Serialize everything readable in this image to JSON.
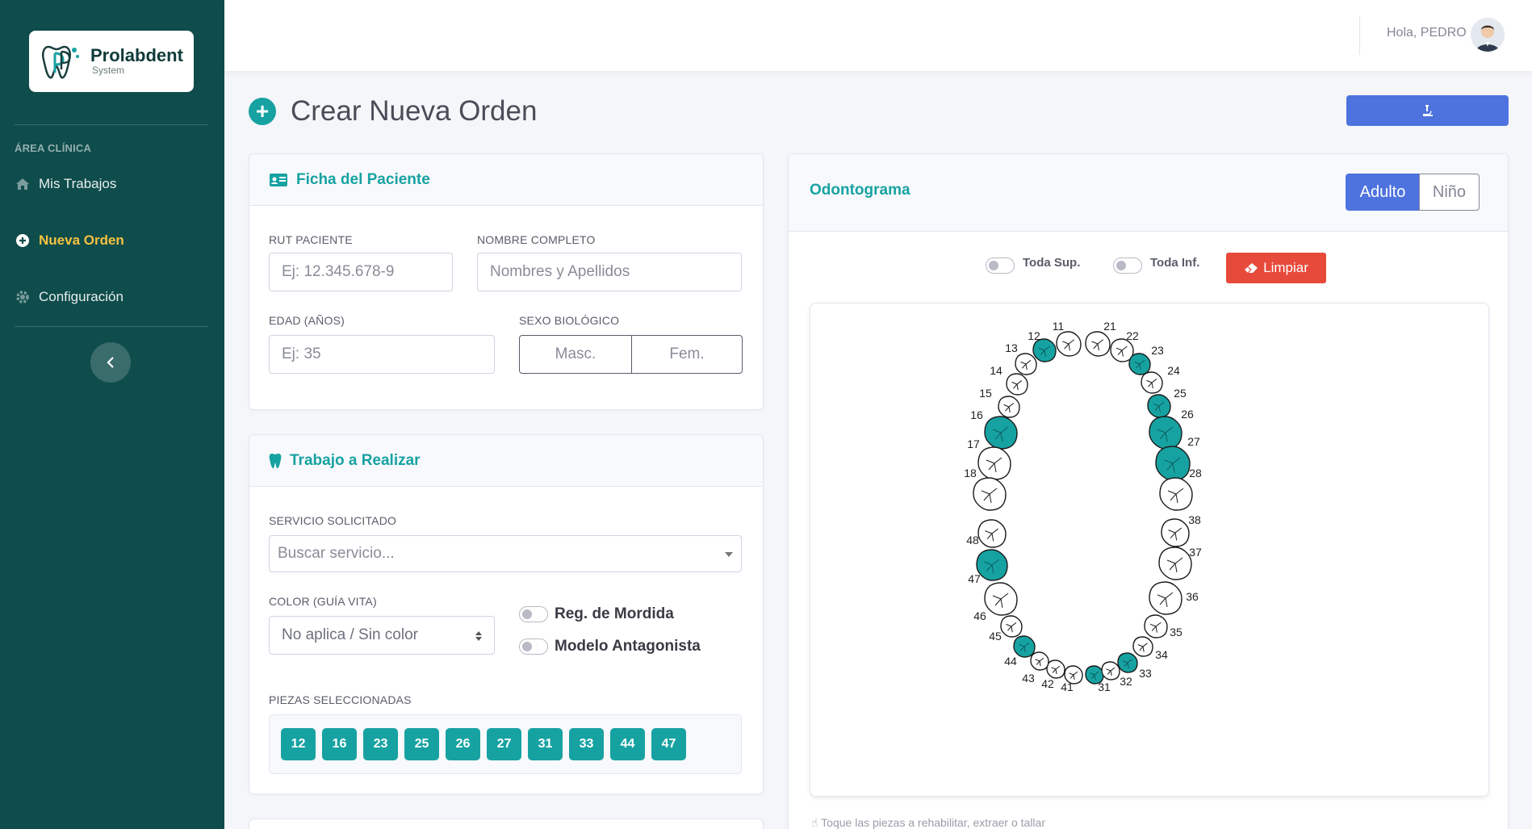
{
  "brand": {
    "name": "Prolabdent",
    "sub": "System"
  },
  "sidebar": {
    "heading": "ÁREA CLÍNICA",
    "items": [
      {
        "label": "Mis Trabajos",
        "icon": "home-icon"
      },
      {
        "label": "Nueva Orden",
        "icon": "plus-circle-icon",
        "active": true
      },
      {
        "label": "Configuración",
        "icon": "gear-icon"
      }
    ]
  },
  "topbar": {
    "greeting": "Hola, PEDRO"
  },
  "page": {
    "title": "Crear Nueva Orden"
  },
  "patient": {
    "title": "Ficha del Paciente",
    "rut_label": "RUT PACIENTE",
    "rut_placeholder": "Ej: 12.345.678-9",
    "name_label": "NOMBRE COMPLETO",
    "name_placeholder": "Nombres y Apellidos",
    "age_label": "EDAD (AÑOS)",
    "age_placeholder": "Ej: 35",
    "sex_label": "SEXO BIOLÓGICO",
    "sex_options": [
      "Masc.",
      "Fem."
    ]
  },
  "work": {
    "title": "Trabajo a Realizar",
    "service_label": "SERVICIO SOLICITADO",
    "service_placeholder": "Buscar servicio...",
    "color_label": "COLOR (GUÍA VITA)",
    "color_value": "No aplica / Sin color",
    "toggle_bite": "Reg. de Mordida",
    "toggle_antagonist": "Modelo Antagonista",
    "pieces_label": "PIEZAS SELECCIONADAS",
    "pieces": [
      "12",
      "16",
      "23",
      "25",
      "26",
      "27",
      "31",
      "33",
      "44",
      "47"
    ]
  },
  "odontogram": {
    "title": "Odontograma",
    "mode_adult": "Adulto",
    "mode_child": "Niño",
    "toggle_upper": "Toda Sup.",
    "toggle_lower": "Toda Inf.",
    "clear_label": "Limpiar",
    "hint": "Toque las piezas a rehabilitar, extraer o tallar",
    "selected_color": "#17a2a2",
    "teeth": [
      {
        "n": "11",
        "sel": false
      },
      {
        "n": "12",
        "sel": true
      },
      {
        "n": "13",
        "sel": false
      },
      {
        "n": "14",
        "sel": false
      },
      {
        "n": "15",
        "sel": false
      },
      {
        "n": "16",
        "sel": true
      },
      {
        "n": "17",
        "sel": false
      },
      {
        "n": "18",
        "sel": false
      },
      {
        "n": "21",
        "sel": false
      },
      {
        "n": "22",
        "sel": false
      },
      {
        "n": "23",
        "sel": true
      },
      {
        "n": "24",
        "sel": false
      },
      {
        "n": "25",
        "sel": true
      },
      {
        "n": "26",
        "sel": true
      },
      {
        "n": "27",
        "sel": true
      },
      {
        "n": "28",
        "sel": false
      },
      {
        "n": "31",
        "sel": true
      },
      {
        "n": "32",
        "sel": false
      },
      {
        "n": "33",
        "sel": true
      },
      {
        "n": "34",
        "sel": false
      },
      {
        "n": "35",
        "sel": false
      },
      {
        "n": "36",
        "sel": false
      },
      {
        "n": "37",
        "sel": false
      },
      {
        "n": "38",
        "sel": false
      },
      {
        "n": "41",
        "sel": false
      },
      {
        "n": "42",
        "sel": false
      },
      {
        "n": "43",
        "sel": false
      },
      {
        "n": "44",
        "sel": true
      },
      {
        "n": "45",
        "sel": false
      },
      {
        "n": "46",
        "sel": false
      },
      {
        "n": "47",
        "sel": true
      },
      {
        "n": "48",
        "sel": false
      }
    ]
  },
  "colors": {
    "sidebar": "#0f4c4c",
    "accent": "#17a2a2",
    "primary": "#4e73df",
    "danger": "#e74a3b",
    "active_nav": "#f6c23e"
  }
}
